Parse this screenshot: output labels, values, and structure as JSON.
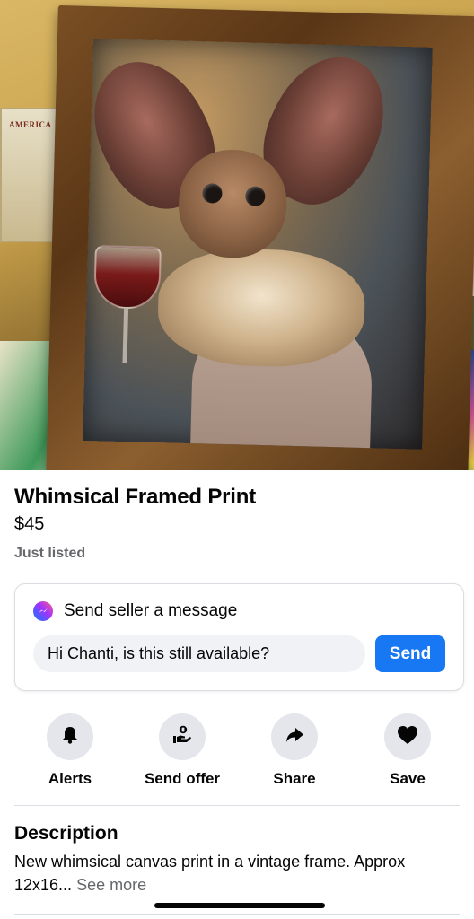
{
  "listing": {
    "title": "Whimsical Framed Print",
    "price": "$45",
    "status": "Just listed",
    "photo_icon": "product-photo",
    "photo_text": "AMERICA"
  },
  "message": {
    "heading": "Send seller a message",
    "input_value": "Hi Chanti, is this still available?",
    "send_label": "Send",
    "icon": "messenger-icon"
  },
  "actions": [
    {
      "label": "Alerts",
      "icon": "bell-icon"
    },
    {
      "label": "Send offer",
      "icon": "offer-hand-icon"
    },
    {
      "label": "Share",
      "icon": "share-arrow-icon"
    },
    {
      "label": "Save",
      "icon": "heart-icon"
    }
  ],
  "description": {
    "heading": "Description",
    "text": "New whimsical canvas print in a vintage frame. Approx 12x16...",
    "see_more": "See more"
  },
  "colors": {
    "accent": "#1877f2",
    "secondary_text": "#65676b",
    "button_bg": "#e4e6eb",
    "input_bg": "#f0f2f5"
  }
}
